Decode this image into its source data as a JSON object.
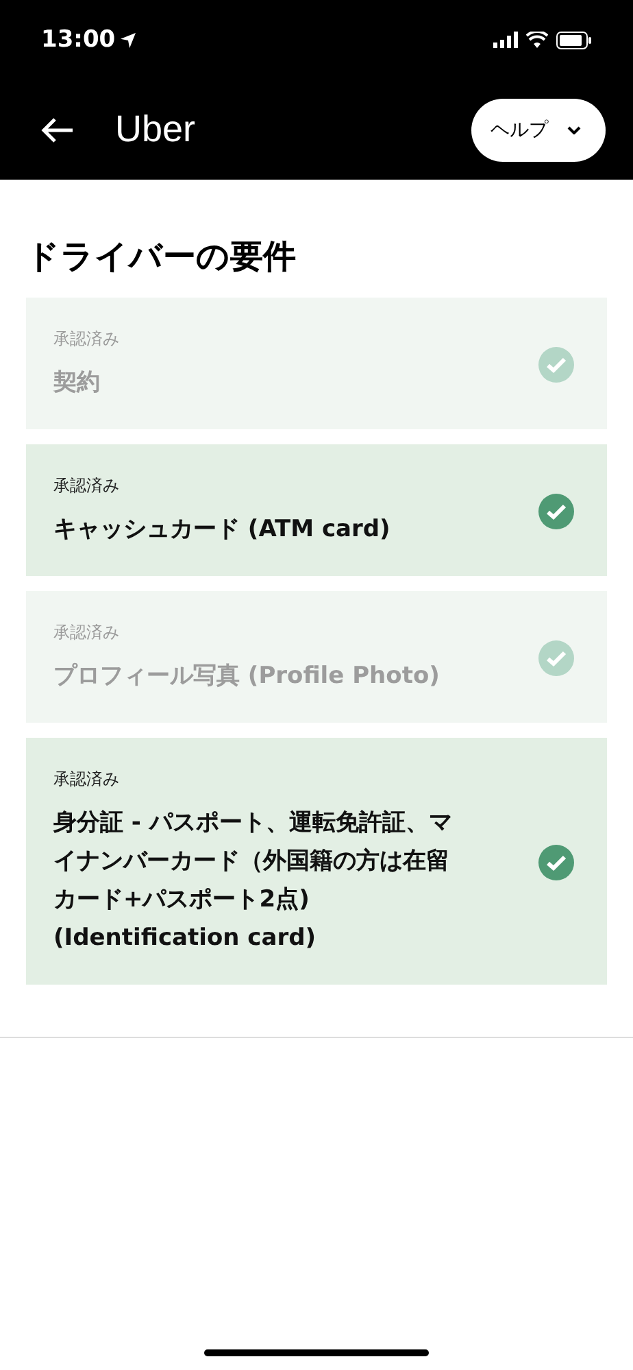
{
  "status_bar": {
    "time": "13:00"
  },
  "header": {
    "title": "Uber",
    "help_button": "ヘルプ"
  },
  "page_title": "ドライバーの要件",
  "requirements": [
    {
      "status": "承認済み",
      "title": "契約",
      "disabled": true
    },
    {
      "status": "承認済み",
      "title": "キャッシュカード (ATM card)",
      "disabled": false
    },
    {
      "status": "承認済み",
      "title": "プロフィール写真 (Profile Photo)",
      "disabled": true
    },
    {
      "status": "承認済み",
      "title": "身分証 - パスポート、運転免許証、マイナンバーカード（外国籍の方は在留カード+パスポート2点) (Identification card)",
      "disabled": false
    }
  ]
}
